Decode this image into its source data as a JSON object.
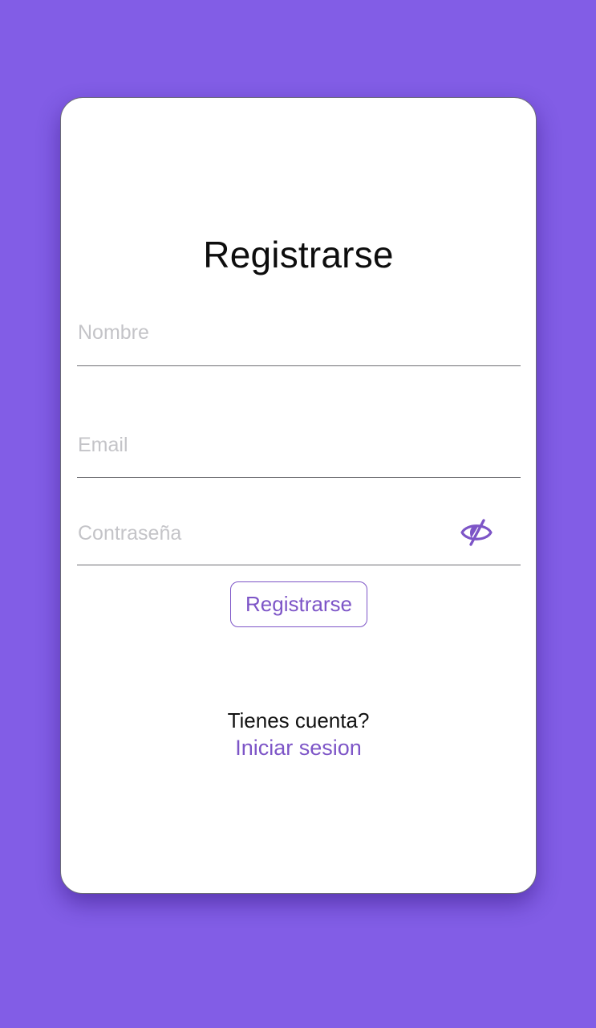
{
  "colors": {
    "background": "#825de6",
    "card": "#ffffff",
    "accent": "#7d55c7",
    "placeholder": "#c4c4c8",
    "underline": "#6f6f74"
  },
  "form": {
    "title": "Registrarse",
    "fields": [
      {
        "id": "name",
        "placeholder": "Nombre",
        "value": ""
      },
      {
        "id": "email",
        "placeholder": "Email",
        "value": ""
      },
      {
        "id": "password",
        "placeholder": "Contraseña",
        "value": "",
        "toggle_icon": "eye-off-icon"
      }
    ],
    "submit_label": "Registrarse"
  },
  "footer": {
    "question": "Tienes cuenta?",
    "login_link": "Iniciar sesion"
  }
}
